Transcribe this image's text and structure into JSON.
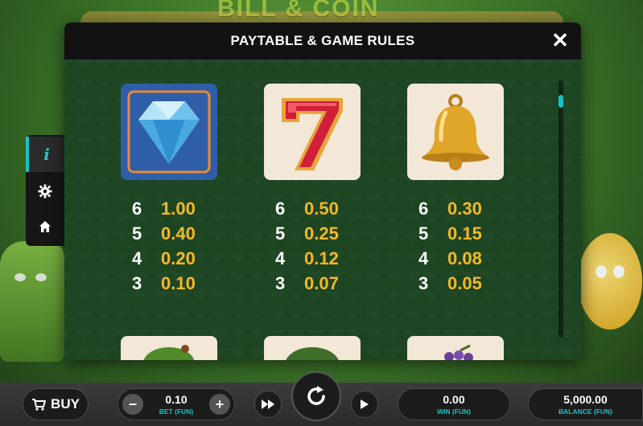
{
  "background": {
    "title": "BILL & COIN"
  },
  "side_menu": {
    "items": [
      {
        "icon": "info-icon",
        "glyph": "i",
        "active": true
      },
      {
        "icon": "gear-icon",
        "glyph": "⚙",
        "active": false
      },
      {
        "icon": "home-icon",
        "glyph": "⌂",
        "active": false
      }
    ]
  },
  "modal": {
    "title": "PAYTABLE & GAME RULES",
    "close_glyph": "✕"
  },
  "paytable": [
    {
      "symbol": "diamond",
      "rows": [
        {
          "count": "6",
          "value": "1.00"
        },
        {
          "count": "5",
          "value": "0.40"
        },
        {
          "count": "4",
          "value": "0.20"
        },
        {
          "count": "3",
          "value": "0.10"
        }
      ]
    },
    {
      "symbol": "seven",
      "rows": [
        {
          "count": "6",
          "value": "0.50"
        },
        {
          "count": "5",
          "value": "0.25"
        },
        {
          "count": "4",
          "value": "0.12"
        },
        {
          "count": "3",
          "value": "0.07"
        }
      ]
    },
    {
      "symbol": "bell",
      "rows": [
        {
          "count": "6",
          "value": "0.30"
        },
        {
          "count": "5",
          "value": "0.15"
        },
        {
          "count": "4",
          "value": "0.08"
        },
        {
          "count": "3",
          "value": "0.05"
        }
      ]
    }
  ],
  "bottom_bar": {
    "buy_label": "BUY",
    "bet_value": "0.10",
    "bet_label": "BET (FUN)",
    "minus_glyph": "−",
    "plus_glyph": "+",
    "win_value": "0.00",
    "win_label": "WIN (FUN)",
    "balance_value": "5,000.00",
    "balance_label": "BALANCE (FUN)"
  },
  "colors": {
    "accent": "#19c0c6",
    "payout": "#f5b826",
    "panel": "#1d4522",
    "header": "#121212"
  }
}
